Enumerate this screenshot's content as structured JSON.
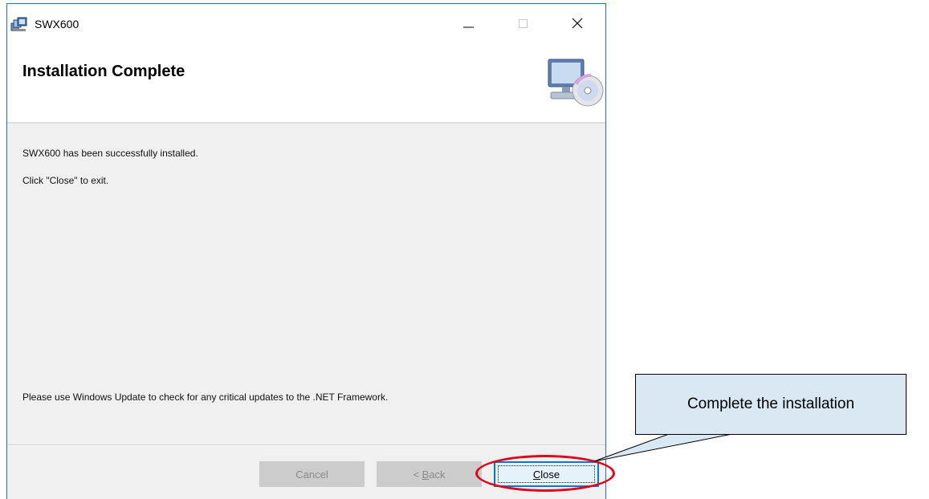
{
  "window": {
    "title": "SWX600",
    "controls": {
      "minimize_icon": "minimize-icon",
      "maximize_icon": "maximize-icon",
      "close_icon": "close-icon"
    }
  },
  "header": {
    "title": "Installation Complete",
    "icon": "setup-computer-disc-icon"
  },
  "content": {
    "line1": "SWX600 has been successfully installed.",
    "line2": "Click \"Close\" to exit.",
    "line3": "Please use Windows Update to check for any critical updates to the .NET Framework."
  },
  "buttons": {
    "cancel": {
      "label": "Cancel",
      "enabled": false
    },
    "back": {
      "prefix": "< ",
      "mnemonic": "B",
      "rest": "ack",
      "enabled": false
    },
    "close": {
      "mnemonic": "C",
      "rest": "lose",
      "enabled": true,
      "focused": true
    }
  },
  "annotation": {
    "callout_text": "Complete the installation",
    "highlight_color": "#e0001a",
    "callout_fill": "#d9e8f2"
  },
  "colors": {
    "window_border": "#1e6fc6",
    "dialog_background": "#f0f0f0",
    "focus_border": "#0078d7"
  }
}
